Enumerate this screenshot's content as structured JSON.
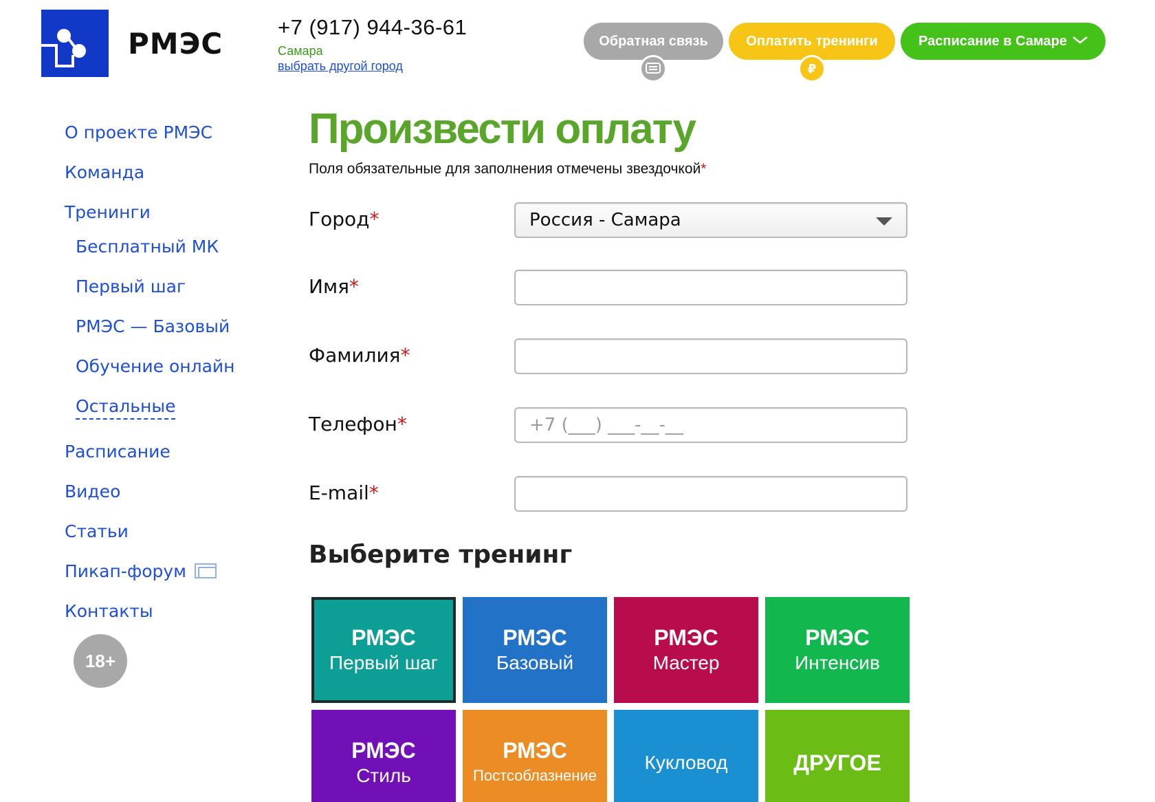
{
  "header": {
    "logo_text": "РМЭС",
    "phone": "+7 (917) 944-36-61",
    "city": "Самара",
    "change_city": "выбрать другой город",
    "buttons": {
      "feedback": "Обратная связь",
      "pay": "Оплатить тренинги",
      "schedule": "Расписание в Самаре"
    },
    "pay_badge": "₽"
  },
  "sidebar": {
    "items": [
      {
        "label": "О проекте РМЭС"
      },
      {
        "label": "Команда"
      },
      {
        "label": "Тренинги"
      },
      {
        "label": "Бесплатный МК"
      },
      {
        "label": "Первый шаг"
      },
      {
        "label": "РМЭС — Базовый"
      },
      {
        "label": "Обучение онлайн"
      },
      {
        "label": "Остальные"
      },
      {
        "label": "Расписание"
      },
      {
        "label": "Видео"
      },
      {
        "label": "Статьи"
      },
      {
        "label": "Пикап-форум"
      },
      {
        "label": "Контакты"
      }
    ],
    "age_badge": "18+"
  },
  "main": {
    "title": "Произвести оплату",
    "required_note": "Поля обязательные для заполнения отмечены звездочкой",
    "required_star": "*",
    "form": {
      "city_label": "Город",
      "city_value": "Россия - Самара",
      "name_label": "Имя",
      "name_value": "",
      "surname_label": "Фамилия",
      "surname_value": "",
      "phone_label": "Телефон",
      "phone_placeholder": "+7 (___) ___-__-__",
      "email_label": "E-mail",
      "email_value": ""
    },
    "training_title": "Выберите тренинг",
    "tiles": [
      {
        "line1": "РМЭС",
        "line2": "Первый шаг",
        "color": "#0d9e96",
        "selected": true
      },
      {
        "line1": "РМЭС",
        "line2": "Базовый",
        "color": "#2272c8"
      },
      {
        "line1": "РМЭС",
        "line2": "Мастер",
        "color": "#b80c4c"
      },
      {
        "line1": "РМЭС",
        "line2": "Интенсив",
        "color": "#12b84e"
      },
      {
        "line1": "РМЭС",
        "line2": "Стиль",
        "color": "#7210b8"
      },
      {
        "line1": "РМЭС",
        "line2": "Постсоблазнение",
        "color": "#ec8c24"
      },
      {
        "line1": "",
        "line2": "Кукловод",
        "color": "#1a90d2"
      },
      {
        "line1": "ДРУГОЕ",
        "line2": "",
        "color": "#6cbc16"
      }
    ]
  },
  "colors": {
    "brand_blue": "#1238c8",
    "link_blue": "#1d4fd8",
    "title_green": "#5aa62a",
    "required_red": "#d01818"
  }
}
